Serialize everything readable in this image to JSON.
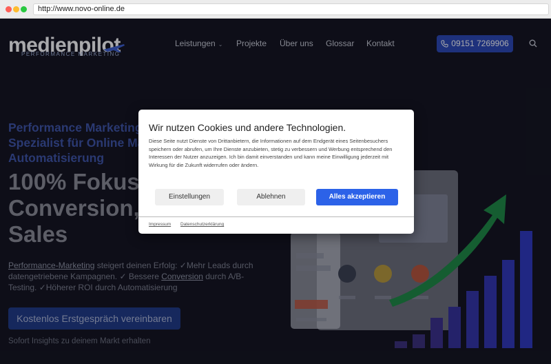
{
  "browser": {
    "url": "http://www.novo-online.de"
  },
  "header": {
    "logo_text": "medienpilot",
    "logo_sub": "PERFORMANCE MARKETING",
    "nav": [
      "Leistungen",
      "Projekte",
      "Über uns",
      "Glossar",
      "Kontakt"
    ],
    "phone": "09151 7269906"
  },
  "hero": {
    "title": "Performance Marketing Agentur Nürnberg: Spezialist für Online Marketing & Automatisierung",
    "headline": "100% Fokus auf Conversion, Leads & Sales",
    "text": {
      "link1": "Performance-Marketing",
      "part1": " steigert deinen Erfolg: ✓Mehr Leads durch datengetriebene Kampagnen. ✓ Bessere ",
      "link2": "Conversion",
      "part2": " durch A/B-Testing. ✓Höherer ROI durch Automatisierung"
    },
    "cta": "Kostenlos Erstgespräch vereinbaren",
    "cta_sub": "Sofort Insights zu deinem Markt erhalten"
  },
  "cookie": {
    "title": "Wir nutzen Cookies und andere Technologien.",
    "body": "Diese Seite nutzt Dienste von Drittanbietern, die Informationen auf dem Endgerät eines Seitenbesuchers speichern oder abrufen, um Ihre Dienste anzubieten, stetig zu verbessern und Werbung entsprechend den Interessen der Nutzer anzuzeigen. Ich bin damit einverstanden und kann meine Einwilligung jederzeit mit Wirkung für die Zukunft widerrufen oder ändern.",
    "settings": "Einstellungen",
    "decline": "Ablehnen",
    "accept": "Alles akzeptieren",
    "links": [
      "Impressum",
      "Datenschutzerklärung"
    ]
  },
  "colors": {
    "accent": "#2c62e8",
    "phone_button": "#2a48b5",
    "page_bg": "#11121c"
  }
}
